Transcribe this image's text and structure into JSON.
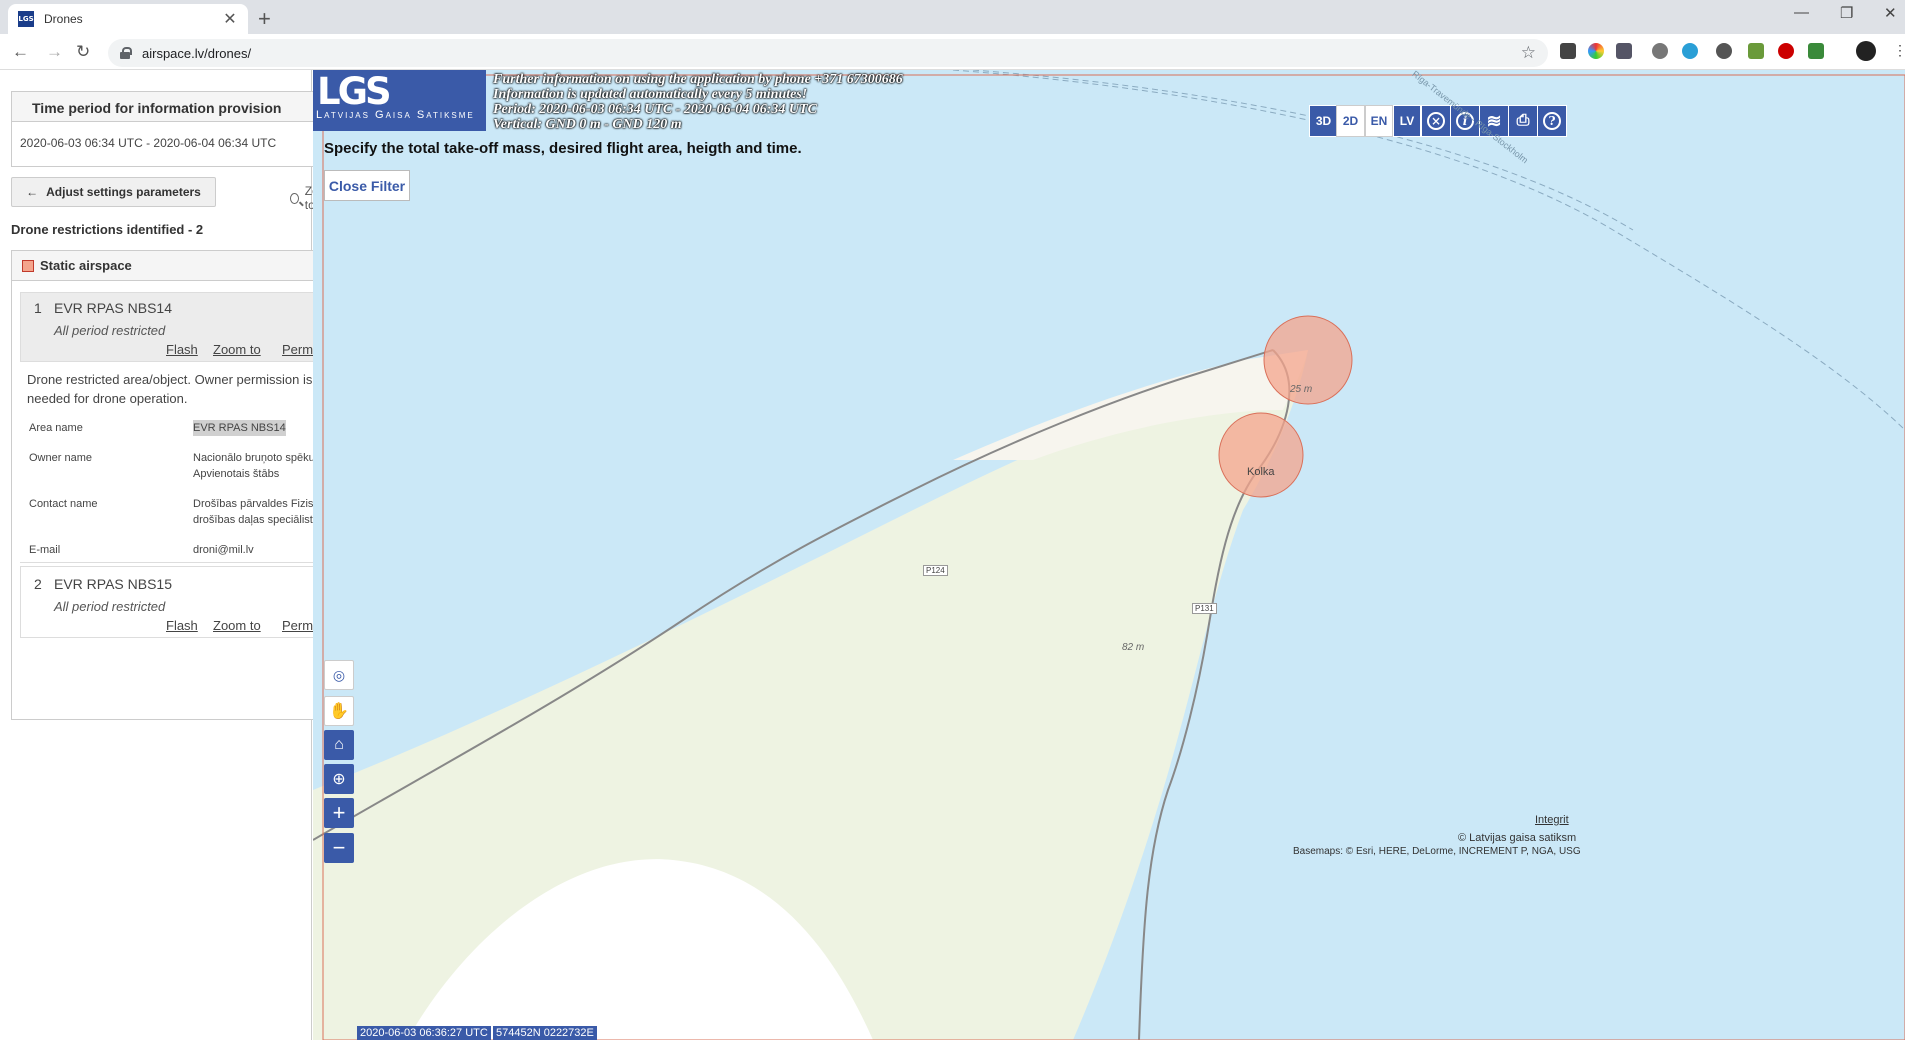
{
  "browser": {
    "tab_title": "Drones",
    "tab_favicon_text": "LGS",
    "url": "airspace.lv/drones/"
  },
  "sidebar": {
    "time_period": {
      "title": "Time period for information provision",
      "value": "2020-06-03 06:34 UTC - 2020-06-04 06:34 UTC"
    },
    "adjust_button": "Adjust settings parameters",
    "zoom_to": "Zoom to",
    "restrictions_title": "Drone restrictions identified - 2",
    "static_airspace": "Static airspace",
    "items": [
      {
        "num": "1",
        "name": "EVR RPAS NBS14",
        "status": "All period restricted",
        "flash": "Flash",
        "zoom": "Zoom to",
        "permission": "Permission",
        "description": "Drone restricted area/object. Owner permission is needed for drone operation.",
        "details": [
          {
            "label": "Area name",
            "value": "EVR RPAS NBS14"
          },
          {
            "label": "Owner name",
            "value": "Nacionālo bruņoto spēku Apvienotais štābs"
          },
          {
            "label": "Contact name",
            "value": "Drošības pārvaldes Fiziskās drošības daļas speciālists"
          },
          {
            "label": "E-mail",
            "value": "droni@mil.lv"
          }
        ]
      },
      {
        "num": "2",
        "name": "EVR RPAS NBS15",
        "status": "All period restricted",
        "flash": "Flash",
        "zoom": "Zoom to",
        "permission": "Permission"
      }
    ]
  },
  "map": {
    "logo_big": "LGS",
    "logo_small": "Latvijas Gaisa Satiksme",
    "info": [
      "Further information on using the application by phone +371 67300686",
      "Information is updated automatically every 5 minutes!",
      "Period: 2020-06-03 06:34 UTC - 2020-06-04 06:34 UTC",
      "Vertical: GND 0 m - GND 120 m"
    ],
    "instruction": "Specify the total take-off mass, desired flight area, heigth and time.",
    "close_filter": "Close Filter",
    "toolbar": [
      "3D",
      "2D",
      "EN",
      "LV"
    ],
    "town": "Kolka",
    "road_labels": [
      "P124",
      "P131"
    ],
    "heights": [
      "25 m",
      "82 m"
    ],
    "ferry_route": "Rīga-Travemünde - Rīga-Stockholm",
    "timestamp": "2020-06-03 06:36:27 UTC",
    "coords": "574452N 0222732E",
    "integrity": "Integrit",
    "copyright": "© Latvijas gaisa satiksm",
    "basemaps": "Basemaps: © Esri, HERE, DeLorme, INCREMENT P, NGA, USG",
    "colors": {
      "accent": "#3a5aa8",
      "water": "#cbe8f7",
      "land": "#eef3e2",
      "restricted": "#f4a48c"
    }
  }
}
